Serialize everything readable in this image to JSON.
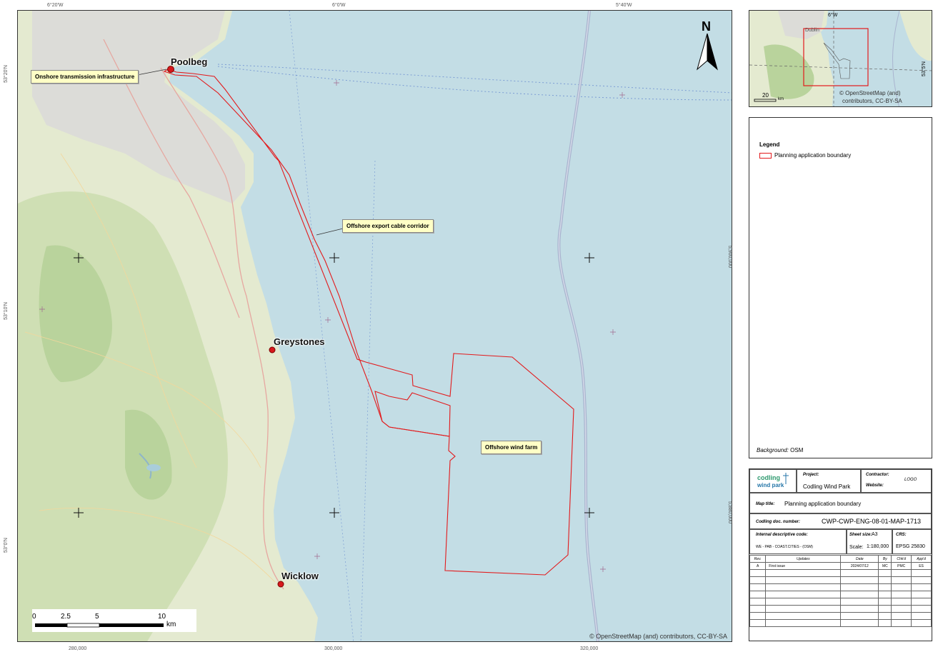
{
  "map": {
    "top_ticks": [
      "6°20'W",
      "6°0'W",
      "5°40'W"
    ],
    "bottom_ticks": [
      "280,000",
      "300,000",
      "320,000"
    ],
    "left_ticks": [
      "53°20'N",
      "53°10'N",
      "53°0'N"
    ],
    "right_ticks": [
      "5,900,000",
      "5,880,000"
    ],
    "places": {
      "poolbeg": "Poolbeg",
      "greystones": "Greystones",
      "wicklow": "Wicklow"
    },
    "callouts": {
      "onshore": "Onshore transmission infrastructure",
      "cable": "Offshore export cable corridor",
      "windfarm": "Offshore wind farm"
    },
    "north": "N",
    "scalebar": {
      "labels": [
        "0",
        "2.5",
        "5",
        "10"
      ],
      "unit": "km"
    },
    "attribution": "© OpenStreetMap (and) contributors, CC-BY-SA",
    "colors": {
      "sea": "#c3dde5",
      "land": "#e4ead0",
      "boundary": "#e31a1c",
      "marker": "#d7191c"
    }
  },
  "inset": {
    "city": "Dublin",
    "lon_label": "6°W",
    "lat_label": "53°5'N",
    "scale_value": "20",
    "scale_unit": "km",
    "attribution_line1": "© OpenStreetMap (and)",
    "attribution_line2": "contributors, CC-BY-SA"
  },
  "legend": {
    "title": "Legend",
    "items": [
      {
        "label": "Planning application boundary",
        "color": "#e31a1c"
      }
    ],
    "background_label": "Background:",
    "background_value": "OSM"
  },
  "title_block": {
    "logo_line1": "codling",
    "logo_line2": "wind park",
    "project_label": "Project:",
    "project_value": "Codling Wind Park",
    "contractor_label": "Contractor:",
    "contractor_value": "LOGO",
    "website_label": "Website:",
    "map_title_label": "Map title:",
    "map_title_value": "Planning application boundary",
    "doc_number_label": "Codling doc. number:",
    "doc_number_value": "CWP-CWP-ENG-08-01-MAP-1713",
    "internal_code_label": "Internal descriptive code:",
    "internal_code_value": "WE - PAB - COAST.CITIES - (OSM)",
    "sheet_size_label": "Sheet size:",
    "sheet_size_value": "A3",
    "scale_label": "Scale:",
    "scale_value": "1:180,000",
    "crs_label": "CRS:",
    "crs_value": "EPSG 25830",
    "revision_headers": [
      "Rev.",
      "Updates",
      "Date",
      "By",
      "Chk'd",
      "App'd"
    ],
    "revisions": [
      [
        "A",
        "First issue",
        "2024/07/12",
        "MC",
        "PMC",
        "ES"
      ]
    ]
  }
}
